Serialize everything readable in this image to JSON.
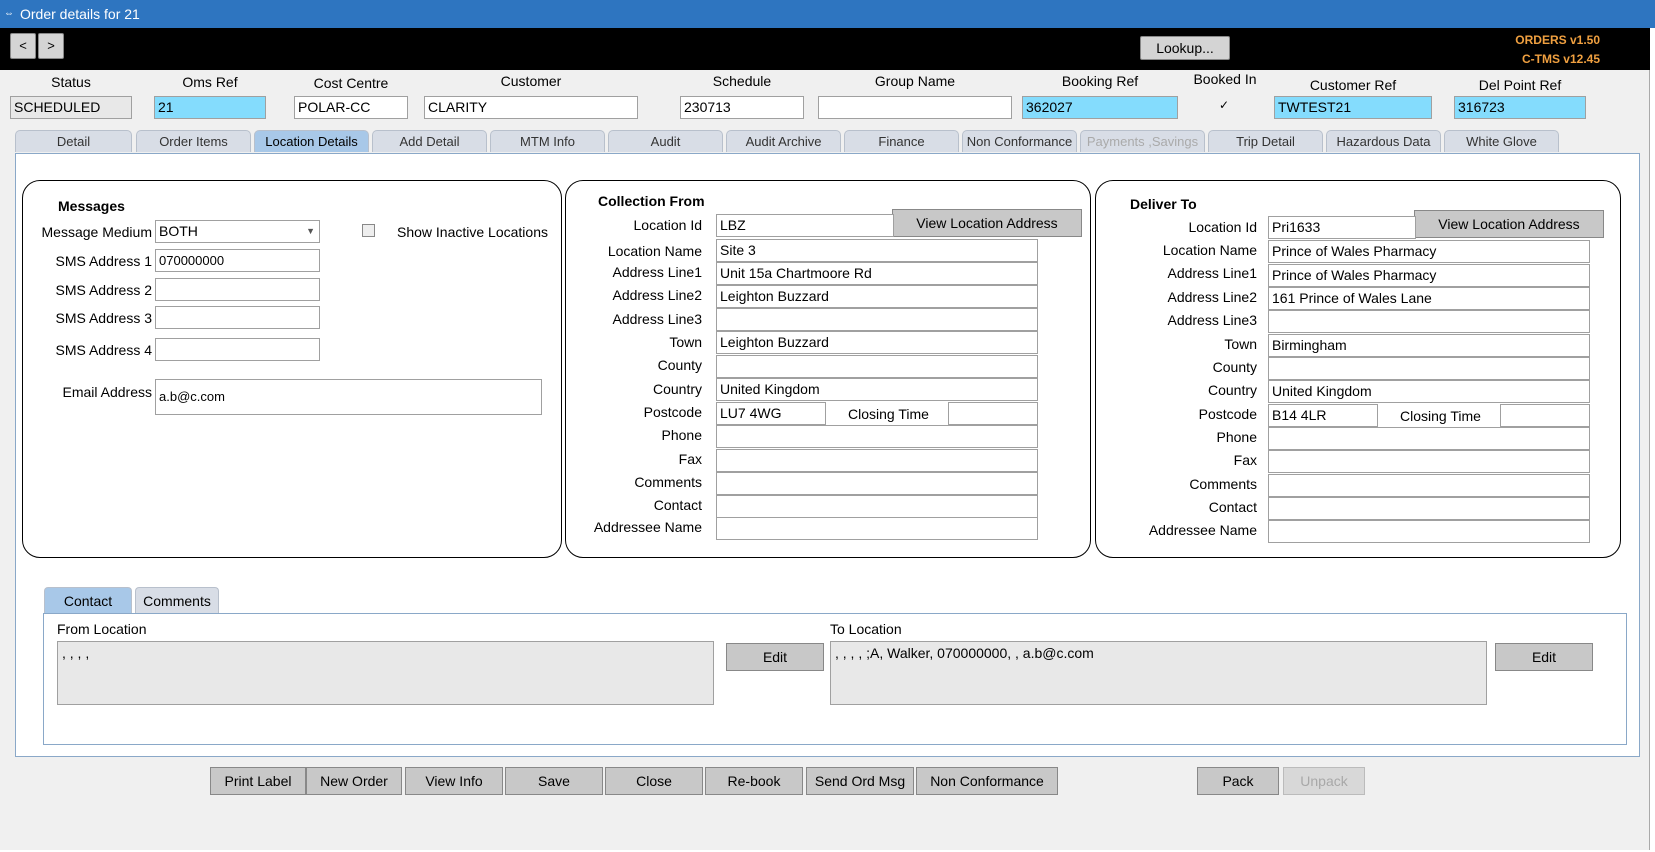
{
  "window": {
    "title": "Order details for 21"
  },
  "toolbar": {
    "back_label": "<",
    "forward_label": ">",
    "lookup_label": "Lookup...",
    "version_orders": "ORDERS v1.50",
    "version_ctms": "C-TMS v12.45"
  },
  "header": {
    "status": {
      "label": "Status",
      "value": "SCHEDULED"
    },
    "oms_ref": {
      "label": "Oms Ref",
      "value": "21"
    },
    "cost_centre": {
      "label": "Cost Centre",
      "value": "POLAR-CC"
    },
    "customer": {
      "label": "Customer",
      "value": "CLARITY"
    },
    "schedule": {
      "label": "Schedule",
      "value": "230713"
    },
    "group_name": {
      "label": "Group Name",
      "value": ""
    },
    "booking_ref": {
      "label": "Booking Ref",
      "value": "362027"
    },
    "booked_in": {
      "label": "Booked In",
      "checked": "✓"
    },
    "customer_ref": {
      "label": "Customer Ref",
      "value": "TWTEST21"
    },
    "del_point_ref": {
      "label": "Del Point Ref",
      "value": "316723"
    }
  },
  "tabs": [
    "Detail",
    "Order Items",
    "Location Details",
    "Add Detail",
    "MTM Info",
    "Audit",
    "Audit Archive",
    "Finance",
    "Non Conformance",
    "Payments ,Savings",
    "Trip Detail",
    "Hazardous Data",
    "White Glove"
  ],
  "messages": {
    "title": "Messages",
    "medium_label": "Message Medium",
    "medium_value": "BOTH",
    "show_inactive_label": "Show Inactive Locations",
    "sms1_label": "SMS Address 1",
    "sms1_value": "070000000",
    "sms2_label": "SMS Address 2",
    "sms2_value": "",
    "sms3_label": "SMS Address 3",
    "sms3_value": "",
    "sms4_label": "SMS Address 4",
    "sms4_value": "",
    "email_label": "Email Address",
    "email_value": "a.b@c.com"
  },
  "labels": {
    "location_id": "Location Id",
    "location_name": "Location Name",
    "address1": "Address Line1",
    "address2": "Address Line2",
    "address3": "Address Line3",
    "town": "Town",
    "county": "County",
    "country": "Country",
    "postcode": "Postcode",
    "closing_time": "Closing Time",
    "phone": "Phone",
    "fax": "Fax",
    "comments": "Comments",
    "contact": "Contact",
    "addressee": "Addressee Name",
    "view_address": "View Location Address"
  },
  "collection": {
    "title": "Collection From",
    "location_id": "LBZ",
    "location_name": "Site 3",
    "address1": "Unit 15a Chartmoore Rd",
    "address2": "Leighton Buzzard",
    "address3": "",
    "town": "Leighton Buzzard",
    "county": "",
    "country": "United Kingdom",
    "postcode": "LU7 4WG",
    "closing_time": "",
    "phone": "",
    "fax": "",
    "comments": "",
    "contact": "",
    "addressee": ""
  },
  "delivery": {
    "title": "Deliver To",
    "location_id": "Pri1633",
    "location_name": "Prince of Wales Pharmacy",
    "address1": "Prince of Wales Pharmacy",
    "address2": "161 Prince of Wales Lane",
    "address3": "",
    "town": "Birmingham",
    "county": "",
    "country": "United Kingdom",
    "postcode": "B14 4LR",
    "closing_time": "",
    "phone": "",
    "fax": "",
    "comments": "",
    "contact": "",
    "addressee": ""
  },
  "contact": {
    "tab_contact": "Contact",
    "tab_comments": "Comments",
    "from_label": "From Location",
    "from_value": ", , , ,",
    "to_label": "To Location",
    "to_value": ", , , , ;A, Walker, 070000000, , a.b@c.com",
    "edit_label": "Edit"
  },
  "footer": {
    "print_label": "Print Label",
    "new_order": "New Order",
    "view_info": "View Info",
    "save": "Save",
    "close": "Close",
    "rebook": "Re-book",
    "send_msg": "Send Ord Msg",
    "non_conformance": "Non Conformance",
    "pack": "Pack",
    "unpack": "Unpack"
  }
}
